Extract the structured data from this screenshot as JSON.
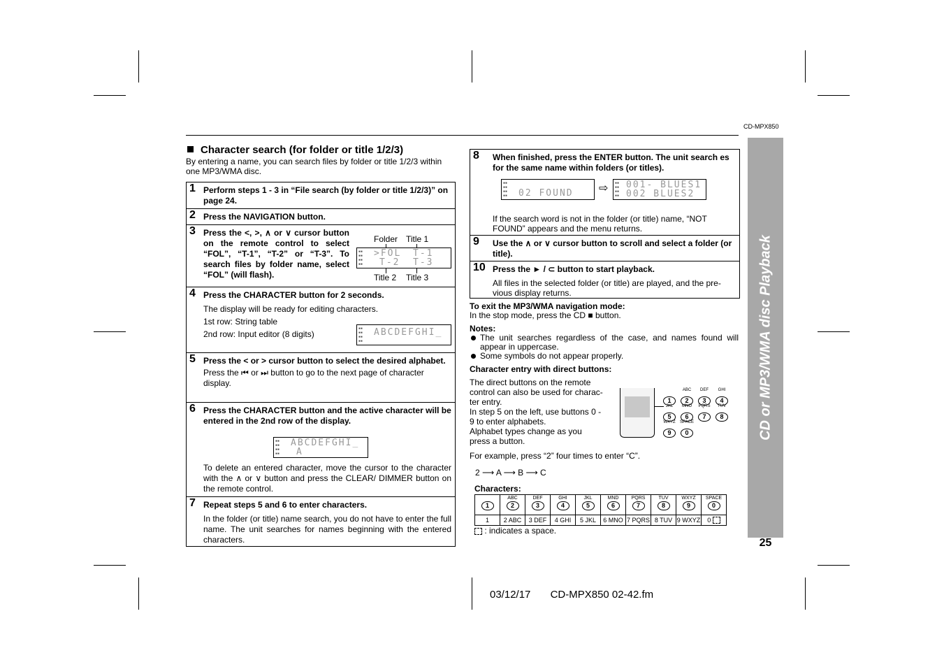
{
  "header": {
    "model": "CD-MPX850"
  },
  "side_tab": {
    "label": "CD or MP3/WMA disc Playback"
  },
  "page_number": "25",
  "footer": {
    "date": "03/12/17",
    "file": "CD-MPX850 02-42.fm"
  },
  "section": {
    "title": "Character search (for folder or title 1/2/3)",
    "intro": "By entering a name, you can search files by folder or title 1/2/3 within one MP3/WMA disc."
  },
  "steps": [
    {
      "num": "1",
      "head": "Perform steps 1 - 3 in “File search (by folder or title 1/2/3)” on page 24."
    },
    {
      "num": "2",
      "head": "Press the NAVIGATION button."
    },
    {
      "num": "3",
      "head": "Press the <, >, ∧ or ∨ cursor button on the remote control to select “FOL”, “T-1”, “T-2” or “T-3”. To search files by folder name, select “FOL” (will flash).",
      "display_labels": {
        "folder": "Folder",
        "title1": "Title 1",
        "title2": "Title 2",
        "title3": "Title 3"
      },
      "display": {
        "row1_left": ">FOL",
        "row1_right": "T-1",
        "row2_left": "T-2",
        "row2_right": "T-3"
      }
    },
    {
      "num": "4",
      "head": "Press the CHARACTER button for 2 seconds.",
      "lines": [
        "The display will be ready for editing characters.",
        "1st row: String table",
        "2nd row: Input editor (8 digits)"
      ],
      "display": {
        "row1": "ABCDEFGHI_",
        "row2": ""
      }
    },
    {
      "num": "5",
      "head": "Press the < or > cursor button to select the desired alphabet.",
      "body": "Press the ⏮ or ⏭ button to go to the next page of character display."
    },
    {
      "num": "6",
      "head": "Press the CHARACTER button and the active character will be entered in the 2nd row of the display.",
      "display": {
        "row1": "ABCDEFGHI_",
        "row2": "A"
      },
      "body": "To delete an entered character, move the cursor to the character with the ∧ or ∨ button and press the CLEAR/ DIMMER button on the remote control."
    },
    {
      "num": "7",
      "head": "Repeat steps 5 and 6 to enter characters.",
      "body": "In the folder (or title) name search, you do not have to enter the full name. The unit searches for names beginning with the entered characters."
    },
    {
      "num": "8",
      "head": "When finished, press the ENTER button. The unit search es for the same name within folders (or titles).",
      "display_before": "02 FOUND",
      "display_after": {
        "row1": "001- BLUES1",
        "row2": "002 BLUES2"
      },
      "body": "If the search word is not in the folder (or title) name, “NOT FOUND” appears and the menu returns."
    },
    {
      "num": "9",
      "head": "Use the ∧ or ∨ cursor button to scroll and select a folder (or title)."
    },
    {
      "num": "10",
      "head": "Press the ► / ⊂ button to start playback.",
      "body": "All files in the selected folder (or title) are played, and the pre- vious display returns."
    }
  ],
  "exit": {
    "title": "To exit the MP3/WMA navigation mode:",
    "body": "In the stop mode, press the CD ■ button."
  },
  "notes": {
    "title": "Notes:",
    "items": [
      "The unit searches regardless of the case, and names found will appear in uppercase.",
      "Some symbols do not appear properly."
    ]
  },
  "direct": {
    "title": "Character entry with direct buttons:",
    "lines": [
      "The direct buttons on the remote",
      "control can also be used for charac-",
      "ter entry.",
      "In step 5 on the left, use buttons 0 -",
      "9 to enter alphabets.",
      "Alphabet types change as you",
      "press a button."
    ],
    "example": "For example, press “2” four times to enter “C”.",
    "sequence": [
      "2",
      "A",
      "B",
      "C"
    ]
  },
  "keypad": [
    {
      "key": "1",
      "label": ""
    },
    {
      "key": "2",
      "label": "ABC"
    },
    {
      "key": "3",
      "label": "DEF"
    },
    {
      "key": "4",
      "label": "GHI"
    },
    {
      "key": "5",
      "label": "JKL"
    },
    {
      "key": "6",
      "label": "MNO"
    },
    {
      "key": "7",
      "label": "PQRS"
    },
    {
      "key": "8",
      "label": "TUV"
    },
    {
      "key": "9",
      "label": "WXYZ"
    },
    {
      "key": "0",
      "label": "SPACE"
    }
  ],
  "characters": {
    "title": "Characters:",
    "top_labels": [
      "",
      "ABC",
      "DEF",
      "GHI",
      "JKL",
      "MND",
      "PQRS",
      "TUV",
      "WXYZ",
      "SPACE"
    ],
    "keys": [
      "1",
      "2",
      "3",
      "4",
      "5",
      "6",
      "7",
      "8",
      "9",
      "0"
    ],
    "values": [
      "1",
      "2 ABC",
      "3 DEF",
      "4 GHI",
      "5 JKL",
      "6 MNO",
      "7 PQRS",
      "8 TUV",
      "9 WXYZ",
      "0"
    ],
    "legend": ": indicates a space."
  }
}
